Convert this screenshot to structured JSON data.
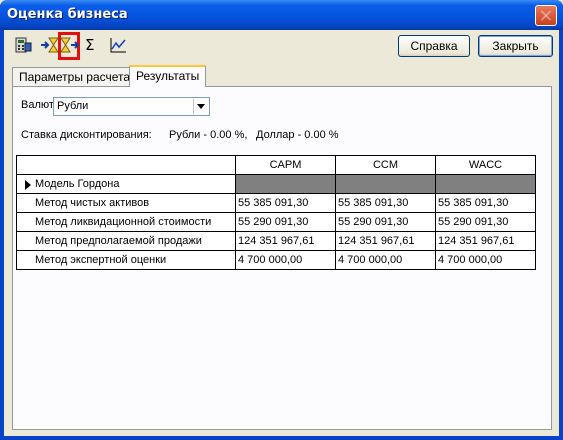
{
  "window": {
    "title": "Оценка бизнеса"
  },
  "toolbar": {
    "icons": [
      "calculator-icon",
      "hourglass-in-icon",
      "hourglass-out-icon",
      "sigma-icon",
      "chart-icon"
    ],
    "help_label": "Справка",
    "close_label": "Закрыть"
  },
  "tabs": [
    {
      "label": "Параметры расчета",
      "active": false
    },
    {
      "label": "Результаты",
      "active": true
    }
  ],
  "currency": {
    "label": "Валюта:",
    "value": "Рубли"
  },
  "discount": {
    "label": "Ставка дисконтирования:",
    "rub": "Рубли -  0.00 %,",
    "usd": "Доллар -  0.00 %"
  },
  "grid": {
    "columns": [
      "CAPM",
      "CCM",
      "WACC"
    ],
    "rows": [
      {
        "name": "Модель Гордона",
        "values": [
          "",
          "",
          ""
        ],
        "current": true
      },
      {
        "name": "Метод чистых активов",
        "values": [
          "55 385 091,30",
          "55 385 091,30",
          "55 385 091,30"
        ]
      },
      {
        "name": "Метод ликвидационной стоимости",
        "values": [
          "55 290 091,30",
          "55 290 091,30",
          "55 290 091,30"
        ]
      },
      {
        "name": "Метод предполагаемой продажи",
        "values": [
          "124 351 967,61",
          "124 351 967,61",
          "124 351 967,61"
        ]
      },
      {
        "name": "Метод экспертной оценки",
        "values": [
          "4 700 000,00",
          "4 700 000,00",
          "4 700 000,00"
        ]
      }
    ]
  }
}
